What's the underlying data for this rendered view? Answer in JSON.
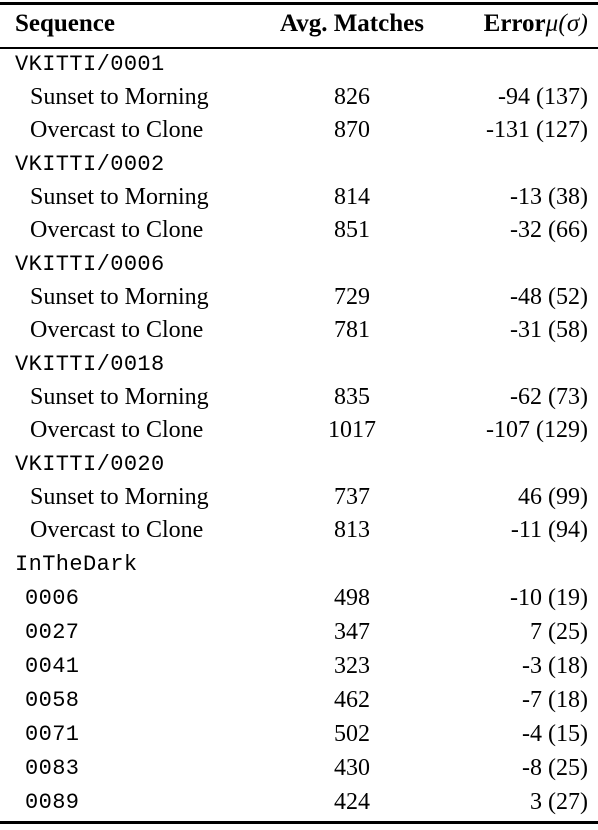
{
  "table": {
    "caption_present": false,
    "columns": [
      {
        "id": "sequence",
        "label": "Sequence",
        "align": "left"
      },
      {
        "id": "avg_matches",
        "label": "Avg. Matches",
        "align": "center"
      },
      {
        "id": "error",
        "label": "Error",
        "label_math": "μ(σ)",
        "align": "right"
      }
    ],
    "rows": [
      {
        "type": "group",
        "indent": 0,
        "font": "mono",
        "sequence": "VKITTI/0001",
        "avg_matches": "",
        "error": ""
      },
      {
        "type": "data",
        "indent": 2,
        "font": "serif",
        "sequence": "Sunset to Morning",
        "avg_matches": "826",
        "error": "-94 (137)"
      },
      {
        "type": "data",
        "indent": 2,
        "font": "serif",
        "sequence": "Overcast to Clone",
        "avg_matches": "870",
        "error": "-131 (127)"
      },
      {
        "type": "group",
        "indent": 0,
        "font": "mono",
        "sequence": "VKITTI/0002",
        "avg_matches": "",
        "error": ""
      },
      {
        "type": "data",
        "indent": 2,
        "font": "serif",
        "sequence": "Sunset to Morning",
        "avg_matches": "814",
        "error": "-13 (38)"
      },
      {
        "type": "data",
        "indent": 2,
        "font": "serif",
        "sequence": "Overcast to Clone",
        "avg_matches": "851",
        "error": "-32 (66)"
      },
      {
        "type": "group",
        "indent": 0,
        "font": "mono",
        "sequence": "VKITTI/0006",
        "avg_matches": "",
        "error": ""
      },
      {
        "type": "data",
        "indent": 2,
        "font": "serif",
        "sequence": "Sunset to Morning",
        "avg_matches": "729",
        "error": "-48 (52)"
      },
      {
        "type": "data",
        "indent": 2,
        "font": "serif",
        "sequence": "Overcast to Clone",
        "avg_matches": "781",
        "error": "-31 (58)"
      },
      {
        "type": "group",
        "indent": 0,
        "font": "mono",
        "sequence": "VKITTI/0018",
        "avg_matches": "",
        "error": ""
      },
      {
        "type": "data",
        "indent": 2,
        "font": "serif",
        "sequence": "Sunset to Morning",
        "avg_matches": "835",
        "error": "-62 (73)"
      },
      {
        "type": "data",
        "indent": 2,
        "font": "serif",
        "sequence": "Overcast to Clone",
        "avg_matches": "1017",
        "error": "-107 (129)"
      },
      {
        "type": "group",
        "indent": 0,
        "font": "mono",
        "sequence": "VKITTI/0020",
        "avg_matches": "",
        "error": ""
      },
      {
        "type": "data",
        "indent": 2,
        "font": "serif",
        "sequence": "Sunset to Morning",
        "avg_matches": "737",
        "error": "46 (99)"
      },
      {
        "type": "data",
        "indent": 2,
        "font": "serif",
        "sequence": "Overcast to Clone",
        "avg_matches": "813",
        "error": "-11 (94)"
      },
      {
        "type": "group",
        "indent": 0,
        "font": "mono",
        "sequence": "InTheDark",
        "avg_matches": "",
        "error": ""
      },
      {
        "type": "data",
        "indent": 1,
        "font": "mono",
        "sequence": "0006",
        "avg_matches": "498",
        "error": "-10 (19)"
      },
      {
        "type": "data",
        "indent": 1,
        "font": "mono",
        "sequence": "0027",
        "avg_matches": "347",
        "error": "7 (25)"
      },
      {
        "type": "data",
        "indent": 1,
        "font": "mono",
        "sequence": "0041",
        "avg_matches": "323",
        "error": "-3 (18)"
      },
      {
        "type": "data",
        "indent": 1,
        "font": "mono",
        "sequence": "0058",
        "avg_matches": "462",
        "error": "-7 (18)"
      },
      {
        "type": "data",
        "indent": 1,
        "font": "mono",
        "sequence": "0071",
        "avg_matches": "502",
        "error": "-4 (15)"
      },
      {
        "type": "data",
        "indent": 1,
        "font": "mono",
        "sequence": "0083",
        "avg_matches": "430",
        "error": "-8 (25)"
      },
      {
        "type": "data",
        "indent": 1,
        "font": "mono",
        "sequence": "0089",
        "avg_matches": "424",
        "error": "3 (27)"
      }
    ]
  },
  "style": {
    "text_color": "#000000",
    "background_color": "#ffffff",
    "rule_color": "#000000"
  }
}
